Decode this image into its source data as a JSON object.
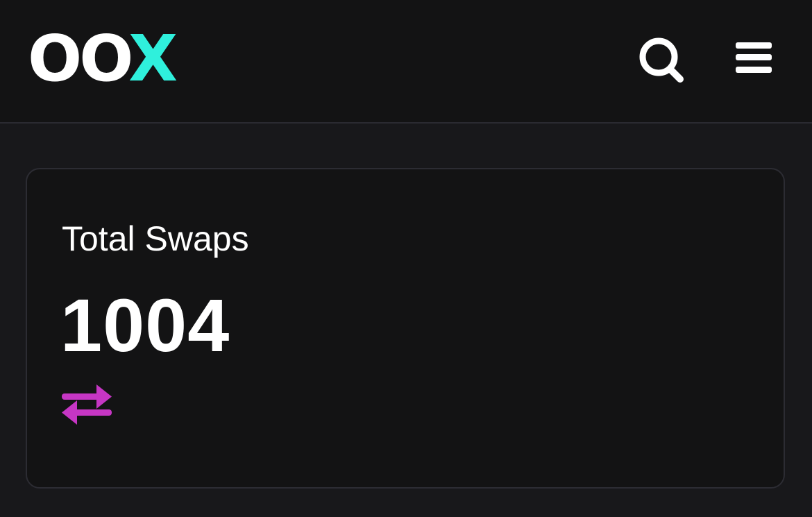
{
  "header": {
    "logo_main": "OO",
    "logo_accent": "X",
    "search_icon": "search-icon",
    "menu_icon": "hamburger-menu-icon"
  },
  "stats_card": {
    "title": "Total Swaps",
    "value": "1004",
    "icon": "swap-arrows-icon"
  },
  "colors": {
    "logo_accent": "#2ff0dc",
    "swap_icon": "#c636c4",
    "header_bg": "#131314",
    "page_bg": "#18181b",
    "card_bg": "#131314",
    "card_border": "#2c2c33"
  }
}
